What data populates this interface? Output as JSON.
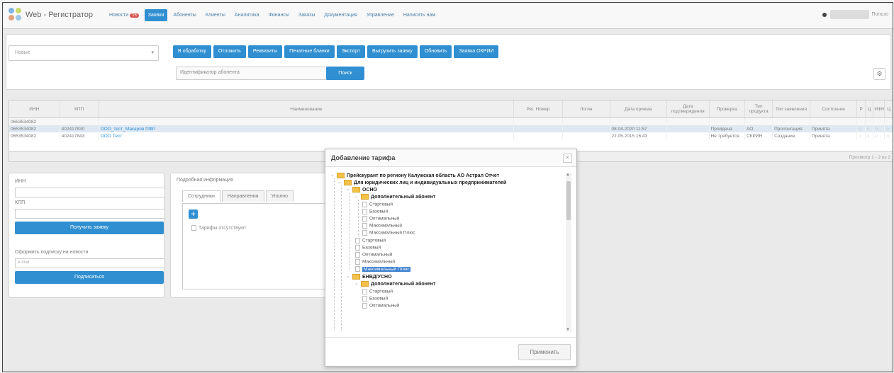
{
  "app": {
    "title": "Web - Регистратор"
  },
  "nav": [
    {
      "label": "Новости",
      "badge": "15"
    },
    {
      "label": "Заявки",
      "active": true
    },
    {
      "label": "Абоненты"
    },
    {
      "label": "Клиенты"
    },
    {
      "label": "Аналитика"
    },
    {
      "label": "Финансы"
    },
    {
      "label": "Заказы"
    },
    {
      "label": "Документация"
    },
    {
      "label": "Управление"
    },
    {
      "label": "Написать нам"
    }
  ],
  "user": {
    "name": "Пользо"
  },
  "filters": {
    "status_select": "Новые",
    "subscriber_id_label": "Идентификатор абонента",
    "search_button": "Поиск"
  },
  "toolbar": [
    "В обработку",
    "Отложить",
    "Реквизиты",
    "Печатные бланки",
    "Экспорт",
    "Выгрузить заявку",
    "Обновить",
    "Заявка ОКРИИ"
  ],
  "grid": {
    "columns": [
      "ИНН",
      "КПП",
      "Наименование",
      "Рег. Номер",
      "Логин",
      "Дата приема",
      "Дата подтверждения",
      "Проверка",
      "Тип продукта",
      "Тип заявления",
      "Состояние",
      "Р",
      "Ц",
      "ИФН",
      "Ц"
    ],
    "filter_inn": "0653534082",
    "rows": [
      {
        "inn": "0653534082",
        "kpp": "402417830",
        "name": "ООО_тест_Макаров ПФР",
        "date": "08.04.2020 11:57",
        "check": "Пройдена",
        "product": "АО",
        "type": "Пролонгация",
        "state": "Принята"
      },
      {
        "inn": "0653534082",
        "kpp": "402417843",
        "name": "ООО Тест",
        "date": "22.05.2015 16:43",
        "check": "Не требуется",
        "product": "СКРИН",
        "type": "Создание",
        "state": "Принята"
      }
    ],
    "pager": "Просмотр 1 - 2 из 2"
  },
  "leftpanel": {
    "inn_label": "ИНН",
    "kpp_label": "КПП",
    "get_button": "Получить заявку",
    "sign_label": "Оформить подписку на новости",
    "email_placeholder": "e-mail",
    "subscribe_button": "Подписаться"
  },
  "detail": {
    "title": "Подробная информация",
    "tabs": [
      "Сотрудники",
      "Направления",
      "Уполно"
    ],
    "no_tariff": "Тарифы отсутствуют"
  },
  "modal": {
    "title": "Добавление тарифа",
    "apply_button": "Применить",
    "tree": {
      "root": "Прейскурант по региону Калужская область АО Астрал Отчет",
      "group": "Для юридических лиц и индивидуальных предпринимателей",
      "osno": "ОСНО",
      "extra": "Дополнительный абонент",
      "extra_items": [
        "Стартовый",
        "Базовый",
        "Оптимальный",
        "Максимальный",
        "Максимальный Плюс"
      ],
      "osno_items": [
        "Стартовый",
        "Базовый",
        "Оптимальный",
        "Максимальный",
        "Максимальный Плюс"
      ],
      "envd": "ЕНВД/УСНО",
      "extra2": "Дополнительный абонент",
      "extra2_items": [
        "Стартовый",
        "Базовый",
        "Оптимальный"
      ]
    }
  }
}
